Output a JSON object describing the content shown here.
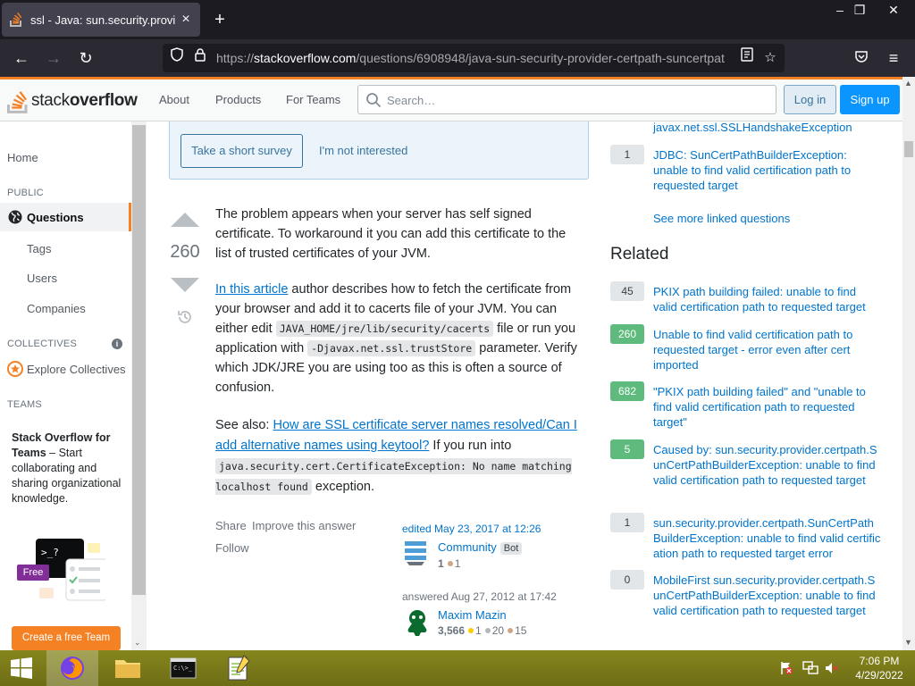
{
  "browser": {
    "tab_title": "ssl - Java: sun.security.provider.c",
    "url_prefix": "https://",
    "url_host": "stackoverflow.com",
    "url_path": "/questions/6908948/java-sun-security-provider-certpath-suncertpat"
  },
  "header": {
    "logo_light": "stack",
    "logo_bold": "overflow",
    "nav": [
      "About",
      "Products",
      "For Teams"
    ],
    "search_placeholder": "Search…",
    "login": "Log in",
    "signup": "Sign up"
  },
  "sidebar": {
    "home": "Home",
    "public_heading": "PUBLIC",
    "questions": "Questions",
    "tags": "Tags",
    "users": "Users",
    "companies": "Companies",
    "collectives_heading": "COLLECTIVES",
    "explore_collectives": "Explore Collectives",
    "teams_heading": "TEAMS",
    "teams_title": "Stack Overflow for Teams",
    "teams_desc": " – Start collaborating and sharing organizational knowledge.",
    "free_badge": "Free",
    "create_team": "Create a free Team"
  },
  "survey": {
    "take_survey": "Take a short survey",
    "not_interested": "I'm not interested"
  },
  "answer": {
    "score": "260",
    "p1": "The problem appears when your server has self signed certificate. To workaround it you can add this certificate to the list of trusted certificates of your JVM.",
    "p2_link": "In this article",
    "p2_a": " author describes how to fetch the certificate from your browser and add it to cacerts file of your JVM. You can either edit ",
    "p2_code1": "JAVA_HOME/jre/lib/security/cacerts",
    "p2_b": " file or run you application with ",
    "p2_code2": "-Djavax.net.ssl.trustStore",
    "p2_c": " parameter. Verify which JDK/JRE you are using too as this is often a source of confusion.",
    "p3_a": "See also: ",
    "p3_link": "How are SSL certificate server names resolved/Can I add alternative names using keytool?",
    "p3_b": " If you run into ",
    "p3_code": "java.security.cert.CertificateException: No name matching localhost found",
    "p3_c": " exception.",
    "share": "Share",
    "improve": "Improve this answer",
    "follow": "Follow",
    "edited": "edited May 23, 2017 at 12:26",
    "editor_name": "Community",
    "editor_badge": "Bot",
    "editor_rep": "1",
    "editor_bronze": "1",
    "answered": "answered Aug 27, 2012 at 17:42",
    "author_name": "Maxim Mazin",
    "author_rep": "3,566",
    "author_gold": "1",
    "author_silver": "20",
    "author_bronze": "15"
  },
  "linked": {
    "top_link": "javax.net.ssl.SSLHandshakeException",
    "item_score": "1",
    "item_title": "JDBC: SunCertPathBuilderException: unable to find valid certification path to requested target",
    "see_more": "See more linked questions"
  },
  "related": {
    "title": "Related",
    "items": [
      {
        "score": "45",
        "title": "PKIX path building failed: unable to find valid certification path to requested target"
      },
      {
        "score": "260",
        "title": "Unable to find valid certification path to requested target - error even after cert imported"
      },
      {
        "score": "682",
        "title": "\"PKIX path building failed\" and \"unable to find valid certification path to requested target\""
      },
      {
        "score": "5",
        "title": "Caused by: sun.security.provider.certpath.SunCertPathBuilderException: unable to find valid certification path to requested target"
      },
      {
        "score": "1",
        "title": "sun.security.provider.certpath.SunCertPathBuilderException: unable to find valid certification path to requested target error"
      },
      {
        "score": "0",
        "title": "MobileFirst sun.security.provider.certpath.SunCertPathBuilderException: unable to find valid certification path to requested target"
      }
    ]
  },
  "taskbar": {
    "time": "7:06 PM",
    "date": "4/29/2022"
  },
  "colors": {
    "accent": "#f48225",
    "link": "#0074cc",
    "accepted_green": "#5eba7d"
  }
}
